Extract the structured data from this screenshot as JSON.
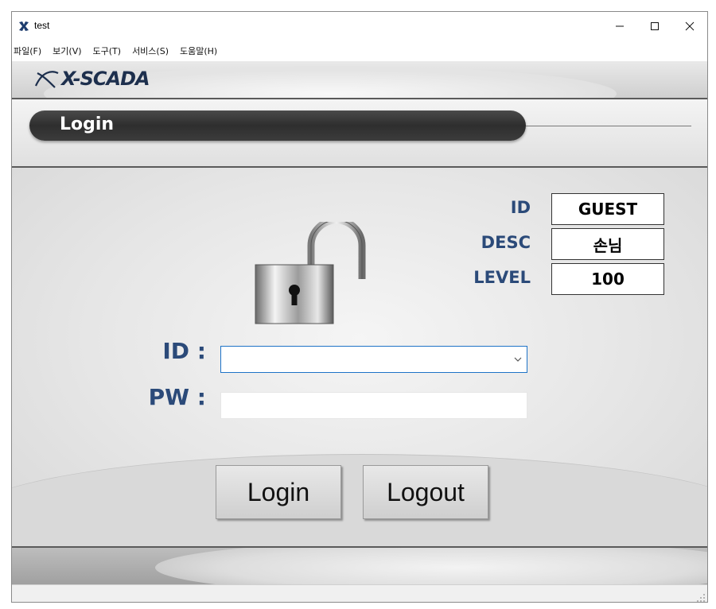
{
  "window": {
    "title": "test",
    "icon": "app-x-icon",
    "controls": [
      "minimize-icon",
      "maximize-icon",
      "close-icon"
    ]
  },
  "menu": {
    "items": [
      "파일(F)",
      "보기(V)",
      "도구(T)",
      "서비스(S)",
      "도움말(H)"
    ]
  },
  "header": {
    "logo_text": "X-SCADA",
    "logo_color": "#1d2f4d"
  },
  "page": {
    "title": "Login"
  },
  "info": {
    "id_label": "ID",
    "id_value": "GUEST",
    "desc_label": "DESC",
    "desc_value": "손님",
    "level_label": "LEVEL",
    "level_value": "100",
    "label_color": "#2b4a79"
  },
  "form": {
    "id_label": "ID :",
    "id_value": "",
    "pw_label": "PW :",
    "pw_value": ""
  },
  "buttons": {
    "login": "Login",
    "logout": "Logout"
  },
  "icons": {
    "lock": "unlocked-padlock-icon",
    "dropdown": "chevron-down-icon",
    "resize": "resize-grip-icon"
  }
}
